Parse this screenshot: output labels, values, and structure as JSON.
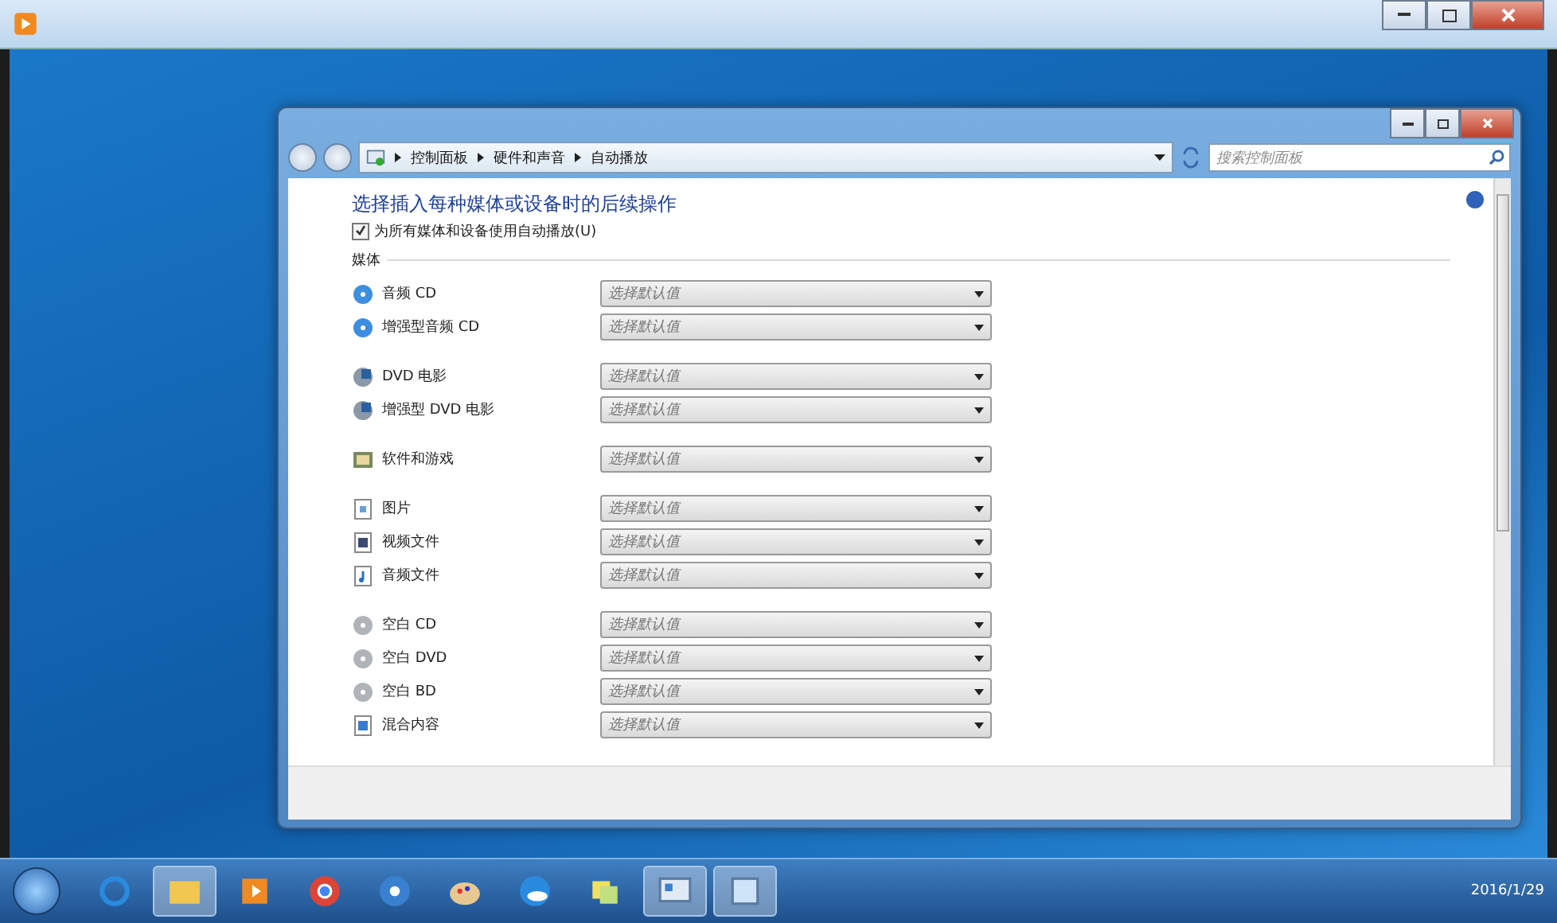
{
  "window": {
    "breadcrumb": [
      "控制面板",
      "硬件和声音",
      "自动播放"
    ],
    "search": {
      "placeholder": "搜索控制面板"
    }
  },
  "content": {
    "heading": "选择插入每种媒体或设备时的后续操作",
    "autoplay_all": {
      "label": "为所有媒体和设备使用自动播放(U)",
      "checked": true
    },
    "section": "媒体",
    "groups": [
      [
        {
          "kind": "cd",
          "label": "音频 CD",
          "value": "选择默认值"
        },
        {
          "kind": "cd",
          "label": "增强型音频 CD",
          "value": "选择默认值"
        }
      ],
      [
        {
          "kind": "dvd",
          "label": "DVD 电影",
          "value": "选择默认值"
        },
        {
          "kind": "dvd",
          "label": "增强型 DVD 电影",
          "value": "选择默认值"
        }
      ],
      [
        {
          "kind": "software",
          "label": "软件和游戏",
          "value": "选择默认值"
        }
      ],
      [
        {
          "kind": "picture",
          "label": "图片",
          "value": "选择默认值"
        },
        {
          "kind": "video",
          "label": "视频文件",
          "value": "选择默认值"
        },
        {
          "kind": "audio",
          "label": "音频文件",
          "value": "选择默认值"
        }
      ],
      [
        {
          "kind": "blank",
          "label": "空白 CD",
          "value": "选择默认值"
        },
        {
          "kind": "blank",
          "label": "空白 DVD",
          "value": "选择默认值"
        },
        {
          "kind": "blank",
          "label": "空白 BD",
          "value": "选择默认值"
        },
        {
          "kind": "mixed",
          "label": "混合内容",
          "value": "选择默认值"
        }
      ]
    ]
  },
  "taskbar": {
    "items": [
      {
        "kind": "ie",
        "highlighted": false
      },
      {
        "kind": "folder",
        "highlighted": true
      },
      {
        "kind": "player",
        "highlighted": false
      },
      {
        "kind": "chrome",
        "highlighted": false
      },
      {
        "kind": "film",
        "highlighted": false
      },
      {
        "kind": "paint",
        "highlighted": false
      },
      {
        "kind": "cloud",
        "highlighted": false
      },
      {
        "kind": "notes",
        "highlighted": false
      },
      {
        "kind": "control",
        "highlighted": true
      },
      {
        "kind": "window",
        "highlighted": true
      }
    ],
    "clock": "2016/1/29"
  }
}
